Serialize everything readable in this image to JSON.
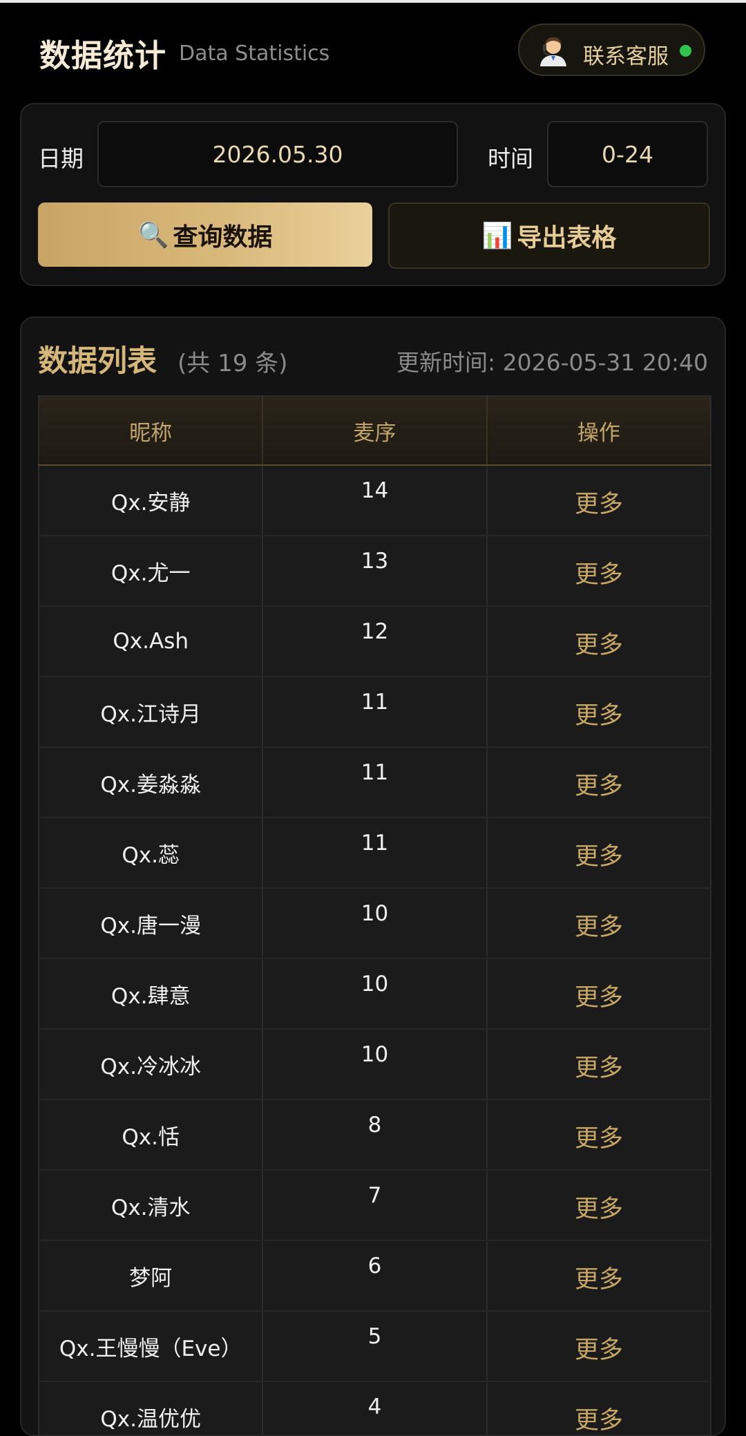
{
  "header": {
    "title": "数据统计",
    "subtitle": "Data Statistics",
    "support_label": "联系客服",
    "support_icon": "customer-service-agent-icon",
    "status_color": "#2fc54d"
  },
  "query": {
    "date_label": "日期",
    "date_value": "2026.05.30",
    "time_label": "时间",
    "time_value": "0-24",
    "query_button": "查询数据",
    "query_icon": "🔍",
    "export_button": "导出表格",
    "export_icon": "📊"
  },
  "list": {
    "title": "数据列表",
    "count_text": "(共 19 条)",
    "update_text": "更新时间: 2026-05-31 20:40",
    "columns": [
      "昵称",
      "麦序",
      "操作"
    ],
    "rows": [
      {
        "name": "Qx.安静",
        "order": "14",
        "action": "更多"
      },
      {
        "name": "Qx.尤一",
        "order": "13",
        "action": "更多"
      },
      {
        "name": "Qx.Ash",
        "order": "12",
        "action": "更多"
      },
      {
        "name": "Qx.江诗月",
        "order": "11",
        "action": "更多"
      },
      {
        "name": "Qx.姜淼淼",
        "order": "11",
        "action": "更多"
      },
      {
        "name": "Qx.蕊",
        "order": "11",
        "action": "更多"
      },
      {
        "name": "Qx.唐一漫",
        "order": "10",
        "action": "更多"
      },
      {
        "name": "Qx.肆意",
        "order": "10",
        "action": "更多"
      },
      {
        "name": "Qx.冷冰冰",
        "order": "10",
        "action": "更多"
      },
      {
        "name": "Qx.恬",
        "order": "8",
        "action": "更多"
      },
      {
        "name": "Qx.清水",
        "order": "7",
        "action": "更多"
      },
      {
        "name": "梦阿",
        "order": "6",
        "action": "更多"
      },
      {
        "name": "Qx.王慢慢（Eve）",
        "order": "5",
        "action": "更多"
      },
      {
        "name": "Qx.温优优",
        "order": "4",
        "action": "更多"
      }
    ]
  },
  "colors": {
    "accent_gold": "#d6b77a",
    "background": "#000000",
    "card": "#131313"
  }
}
